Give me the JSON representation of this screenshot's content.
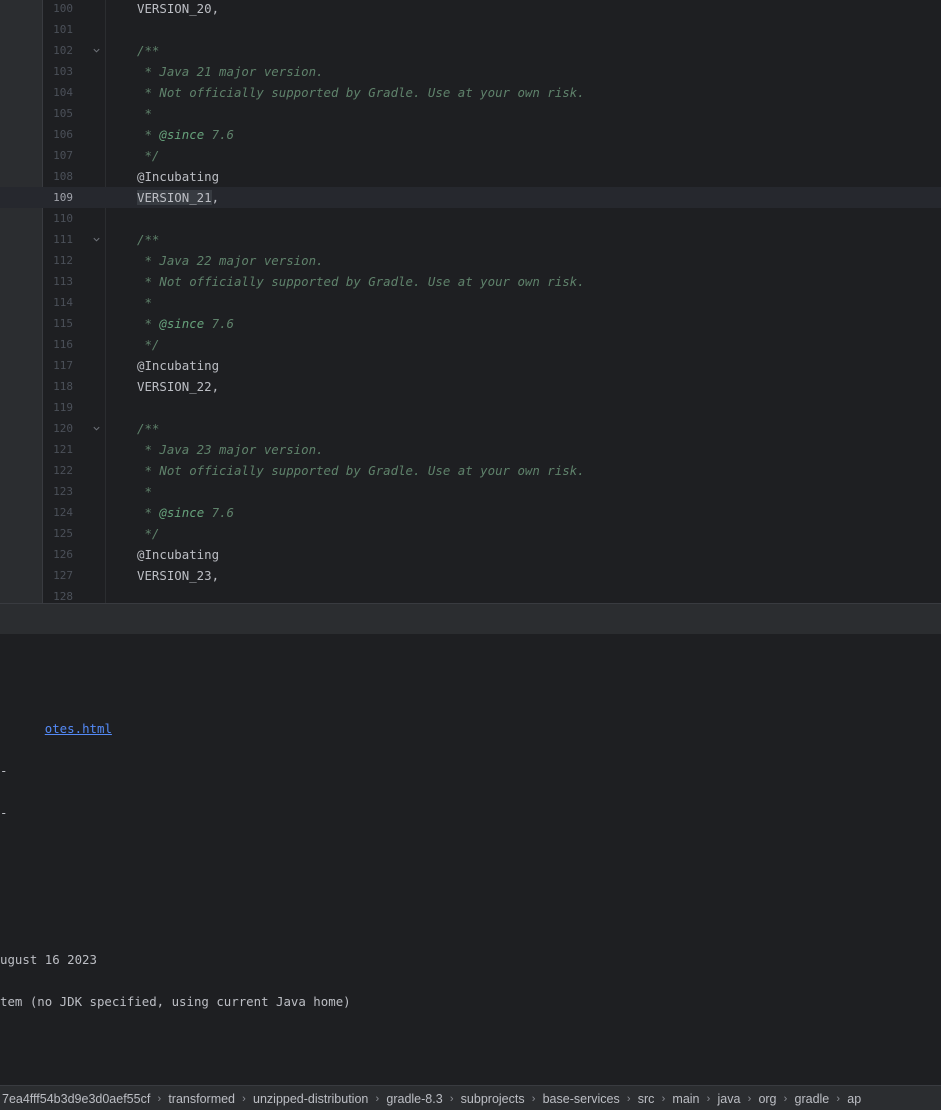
{
  "editor": {
    "current_line": "109",
    "lines": [
      {
        "n": "100",
        "text": "VERSION_20,",
        "kind": "code"
      },
      {
        "n": "101",
        "text": "",
        "kind": "code"
      },
      {
        "n": "102",
        "text": "/**",
        "kind": "comment",
        "fold": true
      },
      {
        "n": "103",
        "text": " * Java 21 major version.",
        "kind": "comment"
      },
      {
        "n": "104",
        "text": " * Not officially supported by Gradle. Use at your own risk.",
        "kind": "comment"
      },
      {
        "n": "105",
        "text": " *",
        "kind": "comment"
      },
      {
        "n": "106",
        "text": " * ",
        "tag": "@since",
        "rest": " 7.6",
        "kind": "since"
      },
      {
        "n": "107",
        "text": " */",
        "kind": "comment"
      },
      {
        "n": "108",
        "text": "@Incubating",
        "kind": "code"
      },
      {
        "n": "109",
        "text": "VERSION_21,",
        "kind": "selected"
      },
      {
        "n": "110",
        "text": "",
        "kind": "code"
      },
      {
        "n": "111",
        "text": "/**",
        "kind": "comment",
        "fold": true
      },
      {
        "n": "112",
        "text": " * Java 22 major version.",
        "kind": "comment"
      },
      {
        "n": "113",
        "text": " * Not officially supported by Gradle. Use at your own risk.",
        "kind": "comment"
      },
      {
        "n": "114",
        "text": " *",
        "kind": "comment"
      },
      {
        "n": "115",
        "text": " * ",
        "tag": "@since",
        "rest": " 7.6",
        "kind": "since"
      },
      {
        "n": "116",
        "text": " */",
        "kind": "comment"
      },
      {
        "n": "117",
        "text": "@Incubating",
        "kind": "code"
      },
      {
        "n": "118",
        "text": "VERSION_22,",
        "kind": "code"
      },
      {
        "n": "119",
        "text": "",
        "kind": "code"
      },
      {
        "n": "120",
        "text": "/**",
        "kind": "comment",
        "fold": true
      },
      {
        "n": "121",
        "text": " * Java 23 major version.",
        "kind": "comment"
      },
      {
        "n": "122",
        "text": " * Not officially supported by Gradle. Use at your own risk.",
        "kind": "comment"
      },
      {
        "n": "123",
        "text": " *",
        "kind": "comment"
      },
      {
        "n": "124",
        "text": " * ",
        "tag": "@since",
        "rest": " 7.6",
        "kind": "since"
      },
      {
        "n": "125",
        "text": " */",
        "kind": "comment"
      },
      {
        "n": "126",
        "text": "@Incubating",
        "kind": "code"
      },
      {
        "n": "127",
        "text": "VERSION_23,",
        "kind": "code"
      },
      {
        "n": "128",
        "text": "",
        "kind": "code"
      }
    ]
  },
  "console": {
    "release_notes_link": "otes.html",
    "dash_1": "-",
    "dash_2": "-",
    "build_time": "ugust 16 2023",
    "toolchain": "tem (no JDK specified, using current Java home)"
  },
  "breadcrumbs": [
    "7ea4fff54b3d9e3d0aef55cf",
    "transformed",
    "unzipped-distribution",
    "gradle-8.3",
    "subprojects",
    "base-services",
    "src",
    "main",
    "java",
    "org",
    "gradle",
    "ap"
  ],
  "colors": {
    "background": "#1e1f22",
    "panel": "#2b2d30",
    "comment": "#5f826b",
    "doc_tag": "#67a37c",
    "link": "#548af7",
    "text": "#bcbec4"
  }
}
